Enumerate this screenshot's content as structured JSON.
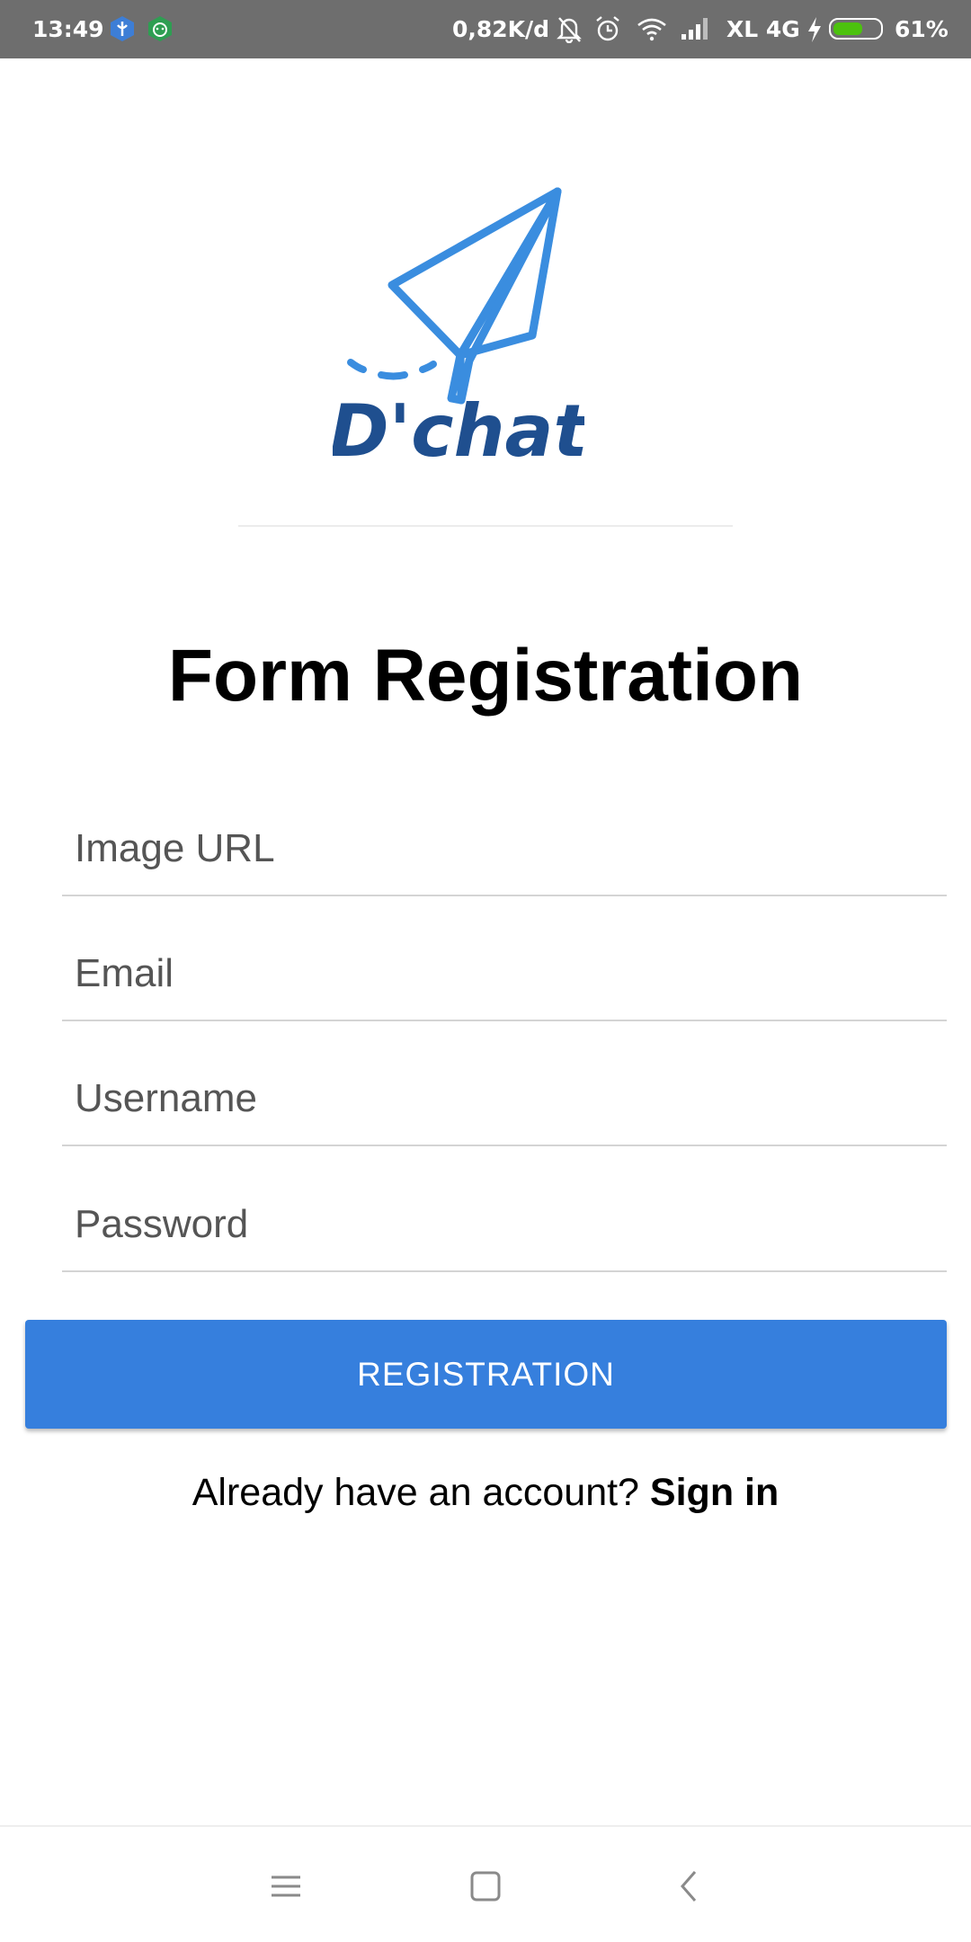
{
  "status_bar": {
    "time": "13:49",
    "network_speed": "0,82K/d",
    "carrier": "XL 4G",
    "battery_percent": "61%",
    "battery_level": 0.61,
    "battery_color": "#4cc20e",
    "icons": [
      "shield-app-icon",
      "android-app-icon",
      "bell-muted-icon",
      "alarm-icon",
      "wifi-icon",
      "signal-icon",
      "charging-icon",
      "battery-icon"
    ]
  },
  "logo": {
    "brand_text": "D'chat",
    "plane_color": "#3a8ddf",
    "text_color": "#1f4f8f"
  },
  "form": {
    "title": "Form Registration",
    "fields": [
      {
        "name": "image-url",
        "placeholder": "Image URL",
        "value": ""
      },
      {
        "name": "email",
        "placeholder": "Email",
        "value": ""
      },
      {
        "name": "username",
        "placeholder": "Username",
        "value": ""
      },
      {
        "name": "password",
        "placeholder": "Password",
        "value": ""
      }
    ],
    "submit_label": "REGISTRATION",
    "accent_color": "#367fdd"
  },
  "signin": {
    "prompt": "Already have an account?",
    "link_label": "Sign in"
  },
  "nav": {
    "icons": [
      "menu-icon",
      "home-square-icon",
      "back-icon"
    ]
  }
}
